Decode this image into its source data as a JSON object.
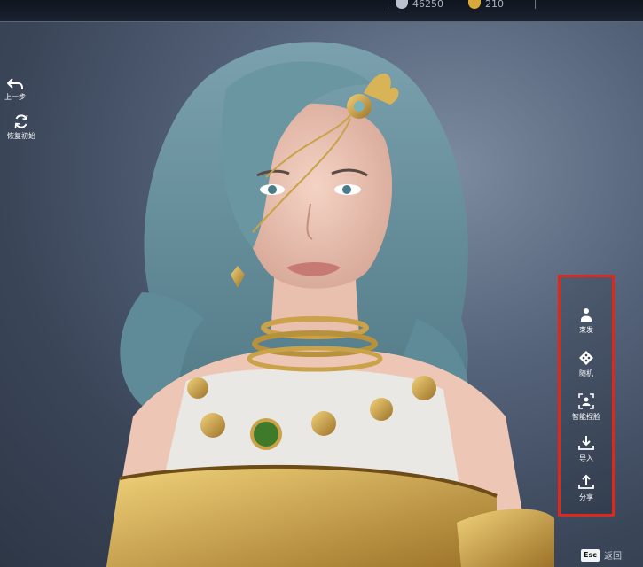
{
  "topbar": {
    "currency_a_value": "46250",
    "currency_a_icon": "coins-icon",
    "currency_b_value": "210",
    "currency_b_icon": "gold-ingot-icon"
  },
  "left_controls": {
    "undo_label": "上一步",
    "undo_icon": "undo-arrow-icon",
    "reset_label": "恢复初始",
    "reset_icon": "refresh-icon"
  },
  "right_panel": {
    "highlight_color": "#e3261b",
    "items": [
      {
        "label": "束发",
        "icon": "hair-tie-icon"
      },
      {
        "label": "随机",
        "icon": "random-dice-icon"
      },
      {
        "label": "智能捏脸",
        "icon": "face-scan-icon"
      },
      {
        "label": "导入",
        "icon": "download-icon"
      },
      {
        "label": "分享",
        "icon": "upload-share-icon"
      }
    ]
  },
  "footer": {
    "esc_key": "Esc",
    "back_label": "返回"
  }
}
